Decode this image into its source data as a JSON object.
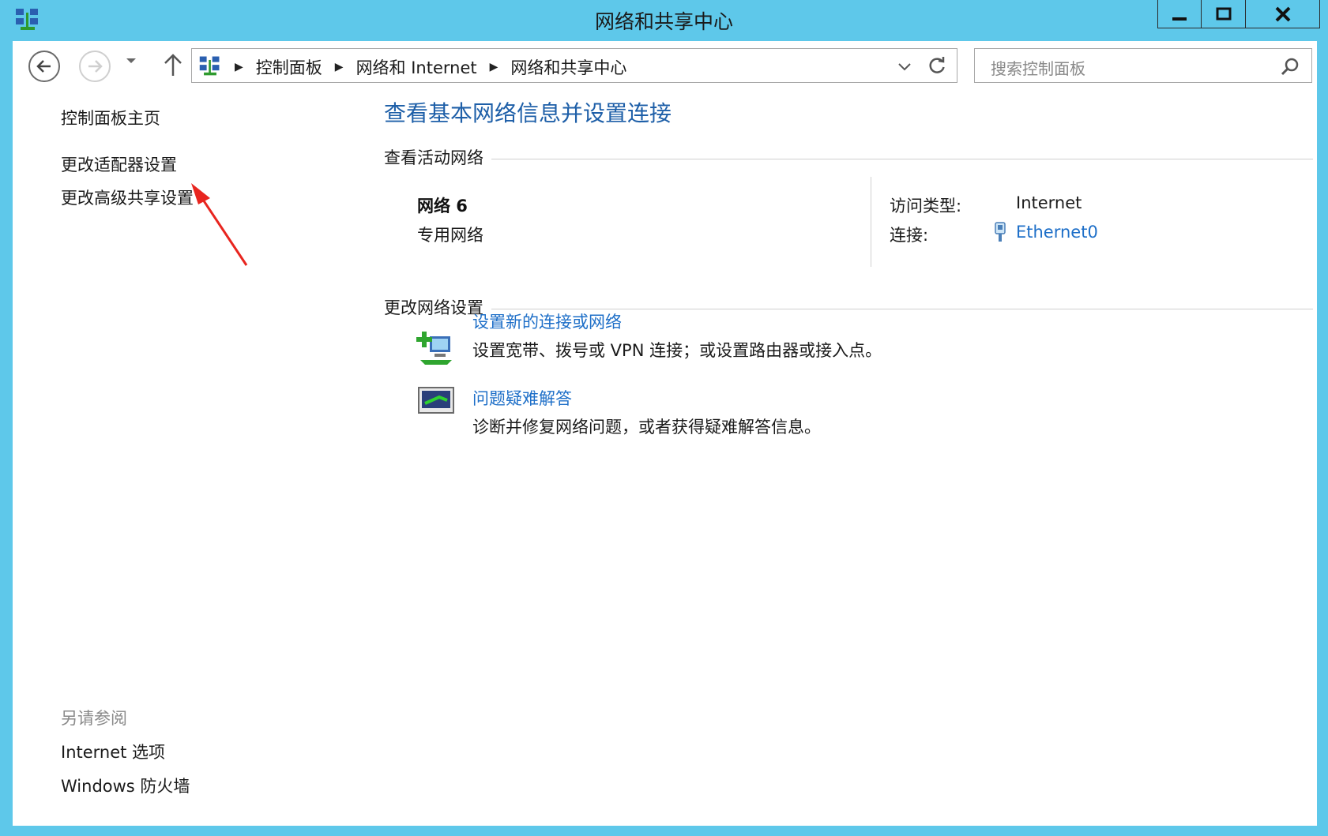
{
  "window": {
    "title": "网络和共享中心",
    "controls": {
      "minimize": "▁",
      "maximize": "□",
      "close": "✕"
    }
  },
  "navigation": {
    "breadcrumbs": [
      "控制面板",
      "网络和 Internet",
      "网络和共享中心"
    ],
    "search_placeholder": "搜索控制面板"
  },
  "sidebar": {
    "links": [
      "控制面板主页",
      "更改适配器设置",
      "更改高级共享设置"
    ],
    "see_also_title": "另请参阅",
    "see_also_links": [
      "Internet 选项",
      "Windows 防火墙"
    ]
  },
  "main": {
    "heading": "查看基本网络信息并设置连接",
    "active_networks_title": "查看活动网络",
    "network": {
      "name": "网络  6",
      "type": "专用网络",
      "access_type_label": "访问类型:",
      "access_type_value": "Internet",
      "connection_label": "连接:",
      "connection_value": "Ethernet0"
    },
    "change_settings_title": "更改网络设置",
    "tasks": [
      {
        "title": "设置新的连接或网络",
        "description": "设置宽带、拨号或 VPN 连接；或设置路由器或接入点。"
      },
      {
        "title": "问题疑难解答",
        "description": "诊断并修复网络问题，或者获得疑难解答信息。"
      }
    ]
  },
  "colors": {
    "window_frame": "#5ec8ea",
    "link_blue": "#1e6fc8",
    "heading_blue": "#1e5fa8",
    "annotation_red": "#e8251f"
  },
  "icons": [
    "network-center-icon",
    "back-arrow-icon",
    "forward-arrow-icon",
    "chevron-down-icon",
    "up-arrow-icon",
    "refresh-icon",
    "search-icon",
    "ethernet-icon",
    "new-connection-icon",
    "troubleshoot-icon"
  ]
}
